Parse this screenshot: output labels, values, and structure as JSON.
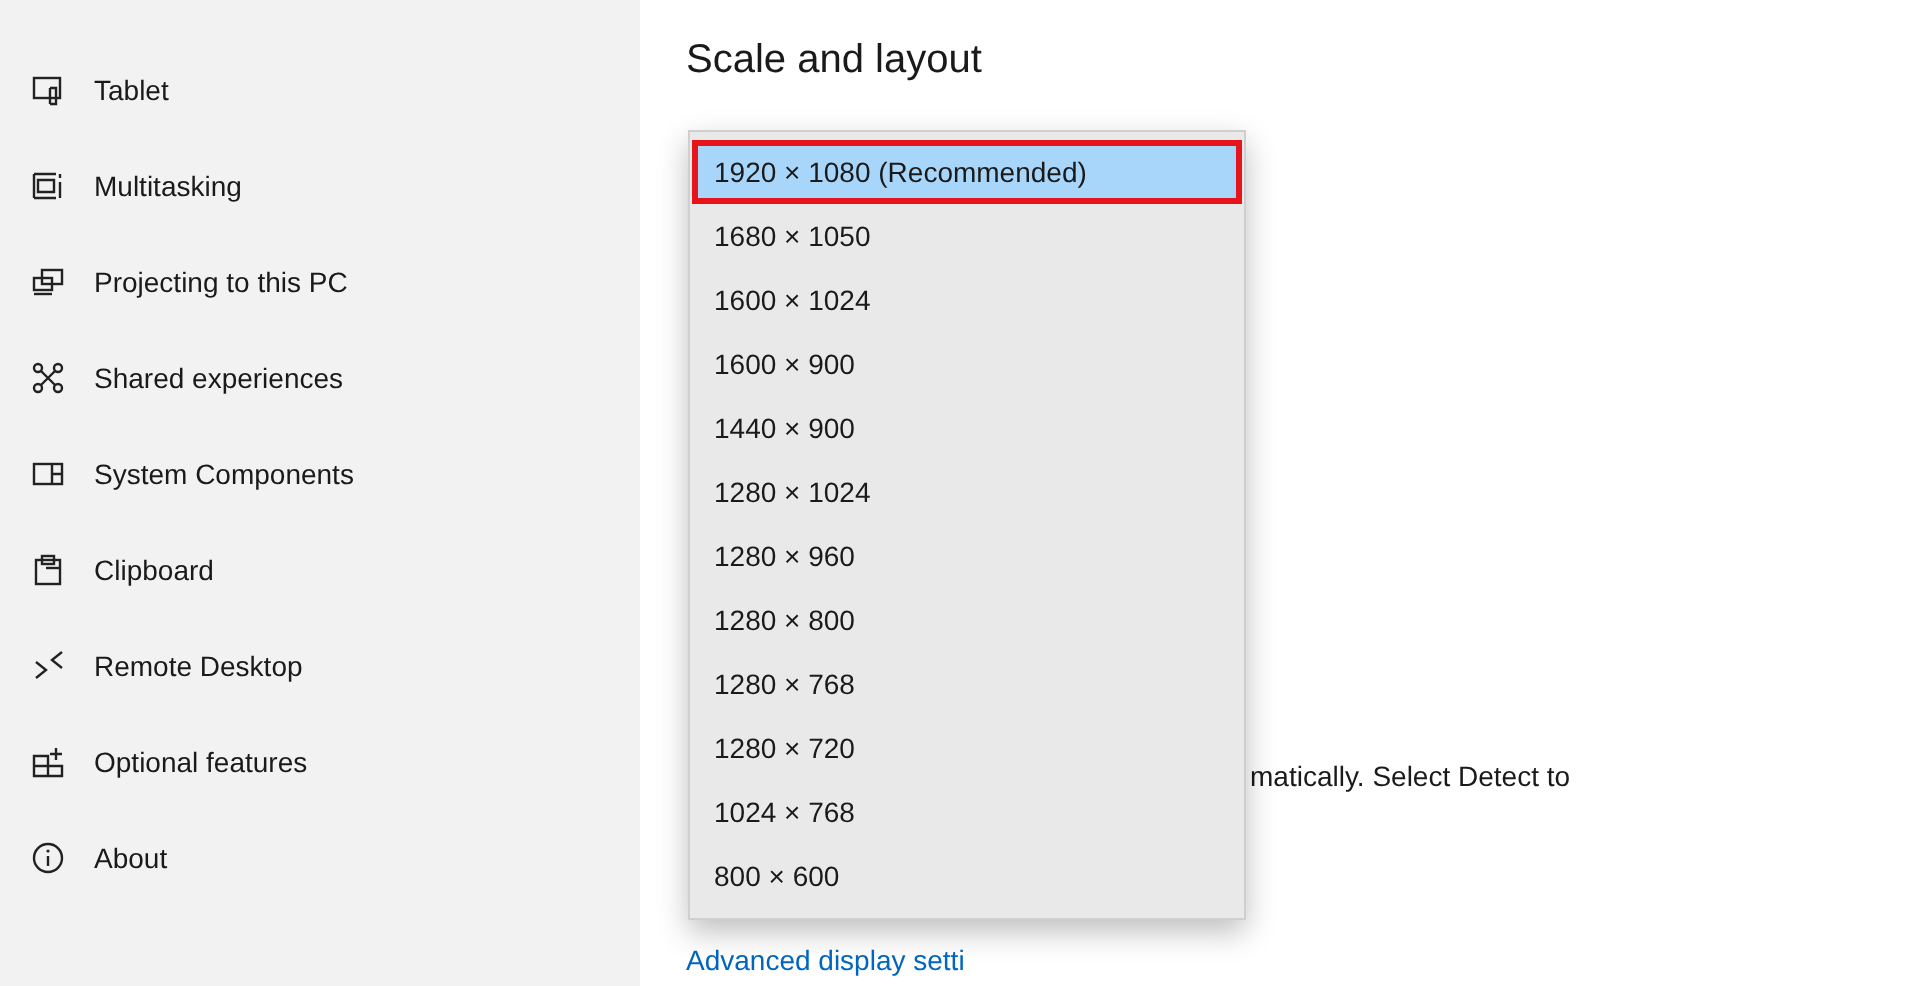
{
  "sidebar": {
    "items": [
      {
        "label": "Tablet",
        "kind": "tablet"
      },
      {
        "label": "Multitasking",
        "kind": "multitasking"
      },
      {
        "label": "Projecting to this PC",
        "kind": "projecting"
      },
      {
        "label": "Shared experiences",
        "kind": "shared"
      },
      {
        "label": "System Components",
        "kind": "components"
      },
      {
        "label": "Clipboard",
        "kind": "clipboard"
      },
      {
        "label": "Remote Desktop",
        "kind": "remote"
      },
      {
        "label": "Optional features",
        "kind": "optional"
      },
      {
        "label": "About",
        "kind": "about"
      }
    ]
  },
  "main": {
    "heading": "Scale and layout",
    "partial_text": "matically. Select Detect to",
    "link": "Advanced display setti"
  },
  "dropdown": {
    "options": [
      {
        "label": "1920 × 1080 (Recommended)",
        "selected": true,
        "annotated": true
      },
      {
        "label": "1680 × 1050",
        "selected": false,
        "annotated": false
      },
      {
        "label": "1600 × 1024",
        "selected": false,
        "annotated": false
      },
      {
        "label": "1600 × 900",
        "selected": false,
        "annotated": false
      },
      {
        "label": "1440 × 900",
        "selected": false,
        "annotated": false
      },
      {
        "label": "1280 × 1024",
        "selected": false,
        "annotated": false
      },
      {
        "label": "1280 × 960",
        "selected": false,
        "annotated": false
      },
      {
        "label": "1280 × 800",
        "selected": false,
        "annotated": false
      },
      {
        "label": "1280 × 768",
        "selected": false,
        "annotated": false
      },
      {
        "label": "1280 × 720",
        "selected": false,
        "annotated": false
      },
      {
        "label": "1024 × 768",
        "selected": false,
        "annotated": false
      },
      {
        "label": "800 × 600",
        "selected": false,
        "annotated": false
      }
    ]
  }
}
